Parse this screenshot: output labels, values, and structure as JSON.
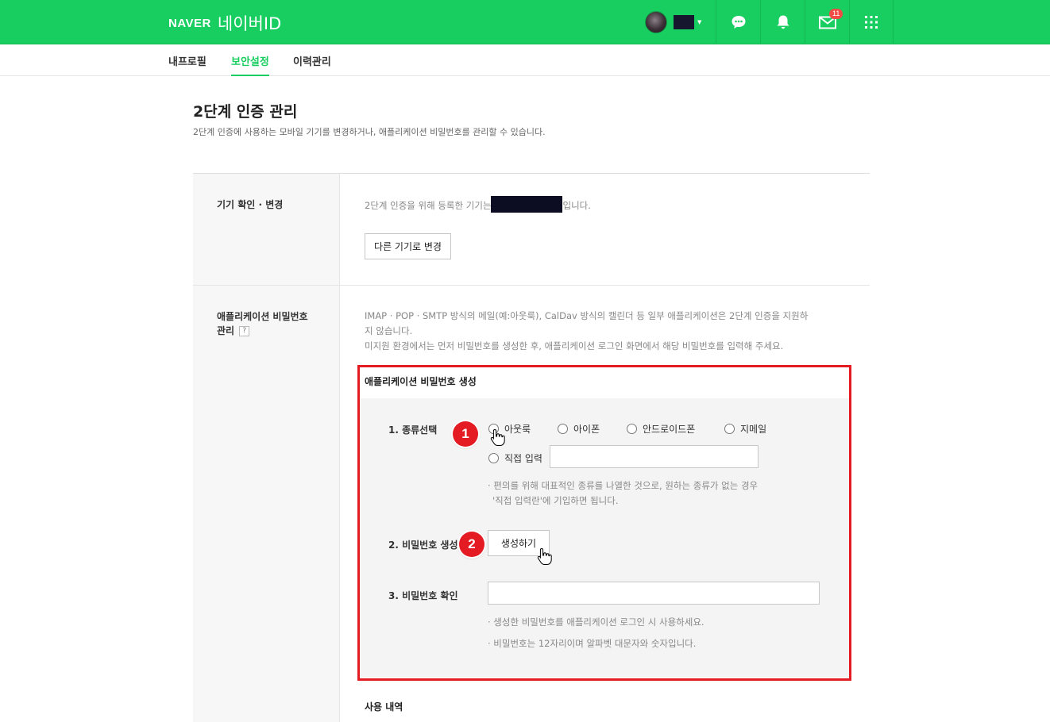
{
  "header": {
    "logo_brand": "NAVER",
    "logo_product": "네이버ID",
    "mail_badge": "11",
    "icons": [
      "chat-bubble-icon",
      "bell-icon",
      "mail-icon",
      "app-grid-icon"
    ],
    "accent_color": "#19ce60"
  },
  "subnav": {
    "tabs": [
      {
        "label": "내프로필",
        "active": false
      },
      {
        "label": "보안설정",
        "active": true
      },
      {
        "label": "이력관리",
        "active": false
      }
    ]
  },
  "page": {
    "title": "2단계 인증 관리",
    "description": "2단계 인증에 사용하는 모바일 기기를 변경하거나, 애플리케이션 비밀번호를 관리할 수 있습니다."
  },
  "device_section": {
    "label": "기기 확인 · 변경",
    "text_before": "2단계 인증을 위해 등록한 기기는",
    "text_after": "입니다.",
    "change_button": "다른 기기로 변경"
  },
  "app_password_section": {
    "label_line1": "애플리케이션 비밀번호",
    "label_line2": "관리",
    "help": "?",
    "desc_line1": "IMAP · POP · SMTP 방식의 메일(예:아웃룩), CalDav 방식의 캘린더 등 일부 애플리케이션은 2단계 인증을 지원하",
    "desc_line2": "지 않습니다.",
    "desc_line3": "미지원 환경에서는 먼저 비밀번호를 생성한 후, 애플리케이션 로그인 화면에서 해당 비밀번호를 입력해 주세요.",
    "box_title": "애플리케이션 비밀번호 생성",
    "step1": {
      "label": "1. 종류선택",
      "options": [
        "아웃룩",
        "아이폰",
        "안드로이드폰",
        "지메일"
      ],
      "custom_option": "직접 입력",
      "note_line1": "· 편의를 위해 대표적인 종류를 나열한 것으로, 원하는 종류가 없는 경우",
      "note_line2": "'직접 입력란'에 기입하면 됩니다."
    },
    "step2": {
      "label": "2. 비밀번호 생성",
      "button": "생성하기"
    },
    "step3": {
      "label": "3. 비밀번호 확인",
      "note1": "· 생성한 비밀번호를 애플리케이션 로그인 시 사용하세요.",
      "note2": "· 비밀번호는 12자리이며 알파벳 대문자와 숫자입니다."
    },
    "markers": [
      "1",
      "2"
    ]
  },
  "usage_section": {
    "title": "사용 내역"
  }
}
